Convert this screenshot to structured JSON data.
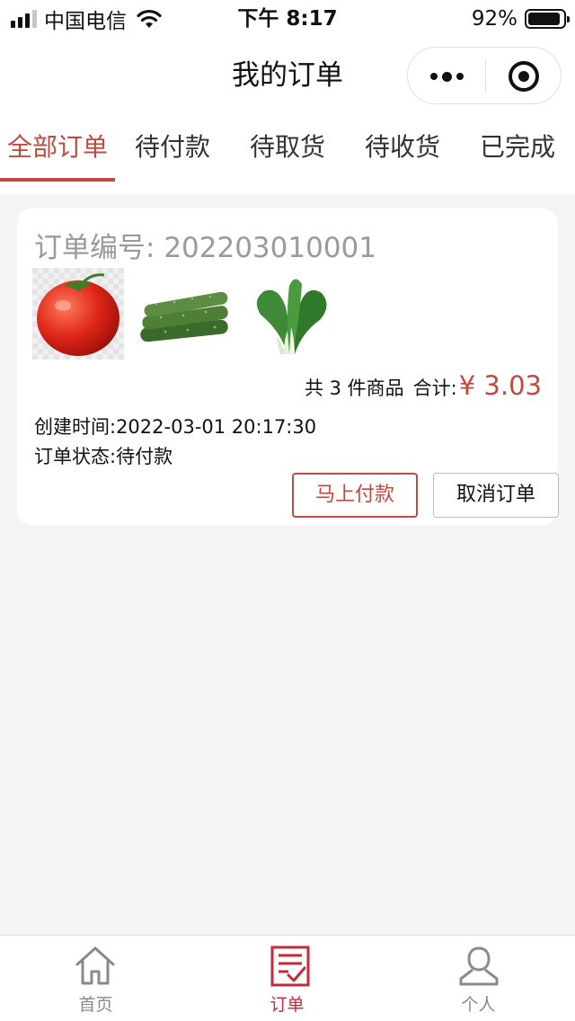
{
  "status_bar": {
    "carrier": "中国电信",
    "time": "下午 8:17",
    "battery_percent": "92%",
    "battery_level": 0.92,
    "signal_bars": 3,
    "signal_bars_total": 4
  },
  "nav": {
    "title": "我的订单"
  },
  "tabs": [
    {
      "label": "全部订单",
      "active": true
    },
    {
      "label": "待付款",
      "active": false
    },
    {
      "label": "待取货",
      "active": false
    },
    {
      "label": "待收货",
      "active": false
    },
    {
      "label": "已完成",
      "active": false
    }
  ],
  "order": {
    "order_no_label": "订单编号:",
    "order_no": "202203010001",
    "products": [
      {
        "icon": "tomato-image"
      },
      {
        "icon": "cucumber-image"
      },
      {
        "icon": "bok-choy-image"
      }
    ],
    "count_text": "共 3 件商品",
    "total_label": "合计:",
    "total_price": "¥ 3.03",
    "created_text": "创建时间:2022-03-01 20:17:30",
    "status_text": "订单状态:待付款",
    "pay_button": "马上付款",
    "cancel_button": "取消订单"
  },
  "tab_bar": {
    "items": [
      {
        "label": "首页",
        "icon": "home-icon",
        "active": false
      },
      {
        "label": "订单",
        "icon": "order-icon",
        "active": true
      },
      {
        "label": "个人",
        "icon": "person-icon",
        "active": false
      }
    ]
  },
  "colors": {
    "accent": "#c6493f",
    "tab_bar_active": "#c6293d",
    "background": "#f4f4f4"
  }
}
